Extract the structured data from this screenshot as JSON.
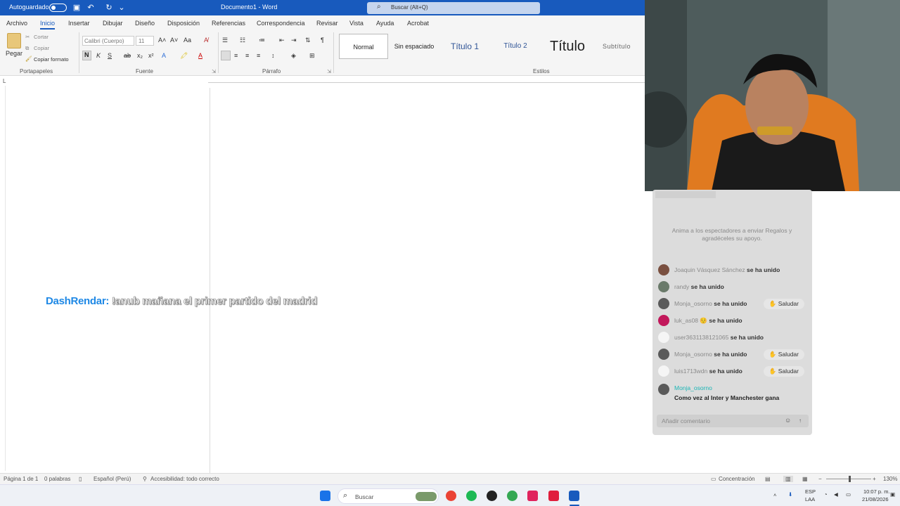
{
  "titlebar": {
    "autosave_label": "Autoguardado",
    "doc_title": "Documento1 - Word",
    "search_placeholder": "Buscar (Alt+Q)"
  },
  "menu": {
    "tabs": [
      "Archivo",
      "Inicio",
      "Insertar",
      "Dibujar",
      "Diseño",
      "Disposición",
      "Referencias",
      "Correspondencia",
      "Revisar",
      "Vista",
      "Ayuda",
      "Acrobat"
    ]
  },
  "ribbon": {
    "clipboard": {
      "paste": "Pegar",
      "cut": "Cortar",
      "copy": "Copiar",
      "format_painter": "Copiar formato",
      "group": "Portapapeles"
    },
    "font": {
      "font_name": "Calibri (Cuerpo)",
      "font_size": "11",
      "bold": "N",
      "italic": "K",
      "underline": "S",
      "group": "Fuente"
    },
    "paragraph": {
      "group": "Párrafo"
    },
    "styles": {
      "group": "Estilos",
      "items": [
        "Normal",
        "Sin espaciado",
        "Título 1",
        "Título 2",
        "Título",
        "Subtítulo"
      ]
    }
  },
  "overlay": {
    "user": "DashRendar:",
    "message": "!anub mañana el primer partido del madrid"
  },
  "chat": {
    "prompt": "Anima a los espectadores a enviar Regalos y agradéceles su apoyo.",
    "joined_suffix": "se ha unido",
    "greet_label": "Saludar",
    "entries": [
      {
        "name": "Joaquin Vásquez Sánchez",
        "avatar_color": "#7a5040"
      },
      {
        "name": "randy",
        "avatar_color": "#6a7a6a"
      },
      {
        "name": "Monja_osorno",
        "avatar_color": "#5a5a5a",
        "greet": true
      },
      {
        "name": "luk_as08 ☺️",
        "avatar_color": "#c2185b"
      },
      {
        "name": "user3631138121065",
        "avatar_color": "#f5f5f5"
      },
      {
        "name": "Monja_osorno",
        "avatar_color": "#5a5a5a",
        "greet": true
      },
      {
        "name": "luis1713wdn",
        "avatar_color": "#f5f5f5",
        "greet": true
      }
    ],
    "comment": {
      "author": "Monja_osorno",
      "text": "Como vez al Inter y Manchester gana"
    },
    "input_placeholder": "Añadir comentario"
  },
  "statusbar": {
    "page": "Página 1 de 1",
    "words": "0 palabras",
    "language": "Español (Perú)",
    "accessibility": "Accesibilidad: todo correcto",
    "focus": "Concentración",
    "zoom": "130%"
  },
  "taskbar": {
    "search_label": "Buscar",
    "lang_top": "ESP",
    "lang_bottom": "LAA",
    "time": "10:07 p. m.",
    "date": "21/08/2026"
  }
}
